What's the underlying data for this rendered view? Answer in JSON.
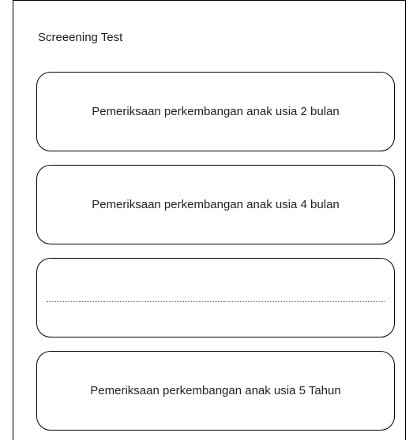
{
  "screen": {
    "title": "Screeening Test"
  },
  "tests": [
    {
      "label": "Pemeriksaan perkembangan anak usia 2 bulan"
    },
    {
      "label": "Pemeriksaan perkembangan anak usia 4 bulan"
    },
    {
      "label": ""
    },
    {
      "label": "Pemeriksaan perkembangan anak usia 5 Tahun"
    }
  ]
}
